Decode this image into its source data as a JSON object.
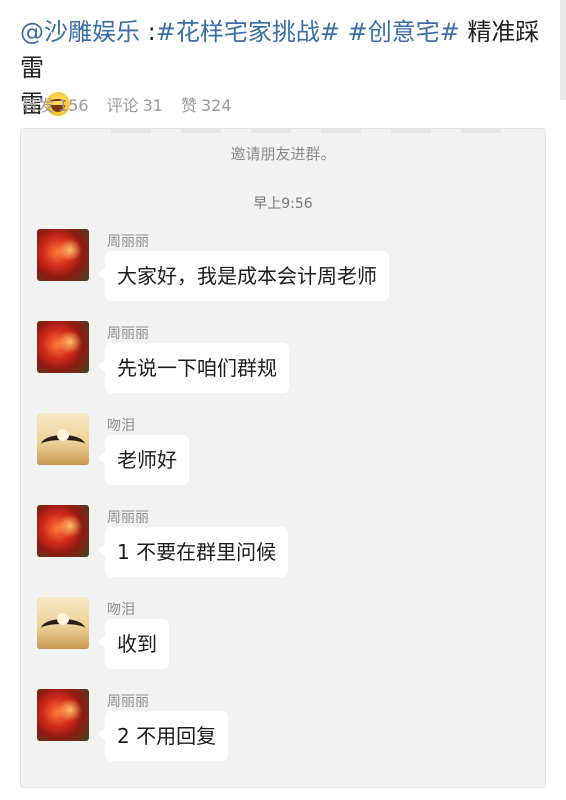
{
  "post": {
    "mention": "@沙雕娱乐",
    "colon": " :",
    "tag1": "#花样宅家挑战#",
    "tag2": "#创意宅#",
    "text": " 精准踩雷",
    "emoji": "laughing-tears-emoji"
  },
  "stats": {
    "repost_label": "转发",
    "repost_count": "156",
    "comment_label": "评论",
    "comment_count": "31",
    "like_label": "赞",
    "like_count": "324"
  },
  "chat": {
    "system_text": "邀请朋友进群。",
    "time": "早上9:56",
    "messages": [
      {
        "name": "周丽丽",
        "text": "大家好，我是成本会计周老师",
        "avatar": "lily-flower-avatar"
      },
      {
        "name": "周丽丽",
        "text": "先说一下咱们群规",
        "avatar": "lily-flower-avatar"
      },
      {
        "name": "吻泪",
        "text": "老师好",
        "avatar": "sunset-hands-avatar"
      },
      {
        "name": "周丽丽",
        "text": "1 不要在群里问候",
        "avatar": "lily-flower-avatar"
      },
      {
        "name": "吻泪",
        "text": "收到",
        "avatar": "sunset-hands-avatar"
      },
      {
        "name": "周丽丽",
        "text": "2 不用回复",
        "avatar": "lily-flower-avatar"
      }
    ]
  }
}
